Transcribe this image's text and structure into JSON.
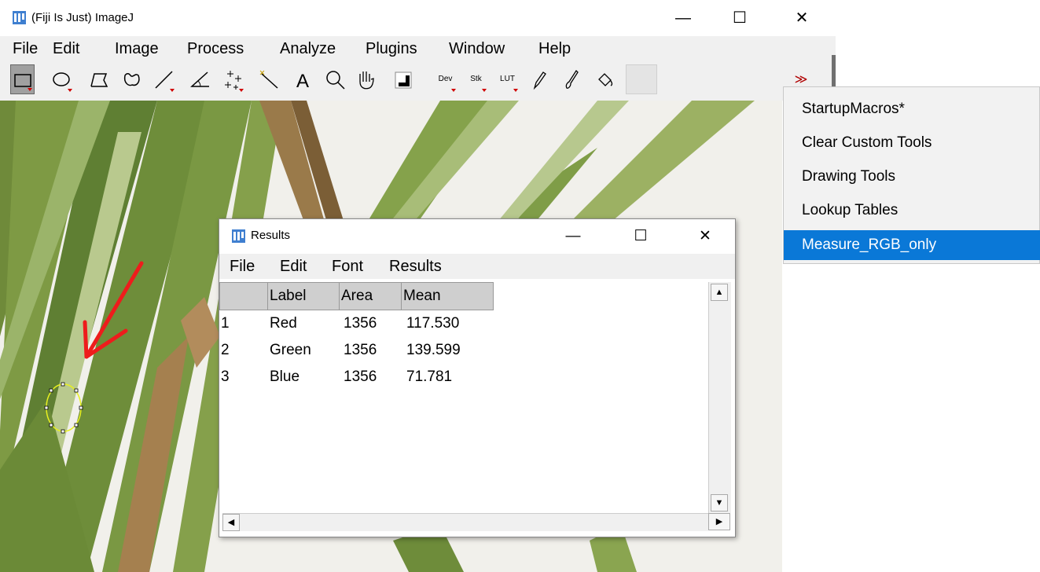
{
  "main_window": {
    "title": "(Fiji Is Just) ImageJ",
    "minimize": "—",
    "maximize": "☐",
    "close": "✕",
    "menus": [
      "File",
      "Edit",
      "Image",
      "Process",
      "Analyze",
      "Plugins",
      "Window",
      "Help"
    ],
    "toolbar": {
      "dev_label": "Dev",
      "stk_label": "Stk",
      "lut_label": "LUT",
      "more_label": "≫"
    }
  },
  "macro_menu": {
    "items": [
      "StartupMacros*",
      "Clear Custom Tools",
      "Drawing Tools",
      "Lookup Tables",
      "Measure_RGB_only"
    ],
    "active_index": 4
  },
  "results_window": {
    "title": "Results",
    "minimize": "—",
    "maximize": "☐",
    "close": "✕",
    "menus": [
      "File",
      "Edit",
      "Font",
      "Results"
    ],
    "columns": [
      "",
      "Label",
      "Area",
      "Mean"
    ],
    "rows": [
      {
        "index": "1",
        "label": "Red",
        "area": "1356",
        "mean": "117.530"
      },
      {
        "index": "2",
        "label": "Green",
        "area": "1356",
        "mean": "139.599"
      },
      {
        "index": "3",
        "label": "Blue",
        "area": "1356",
        "mean": "71.781"
      }
    ]
  },
  "colors": {
    "menu_highlight": "#0a78d7",
    "annotation_arrow": "#ee1c1c",
    "selection_outline": "#e8f020"
  },
  "icons": [
    "imagej-app-icon",
    "rectangle-tool-icon",
    "oval-tool-icon",
    "polygon-tool-icon",
    "freehand-tool-icon",
    "line-tool-icon",
    "angle-tool-icon",
    "multipoint-tool-icon",
    "wand-tool-icon",
    "text-tool-icon",
    "magnifier-icon",
    "hand-tool-icon",
    "color-picker-icon",
    "pencil-icon",
    "brush-icon",
    "flood-fill-icon",
    "more-tools-icon"
  ]
}
